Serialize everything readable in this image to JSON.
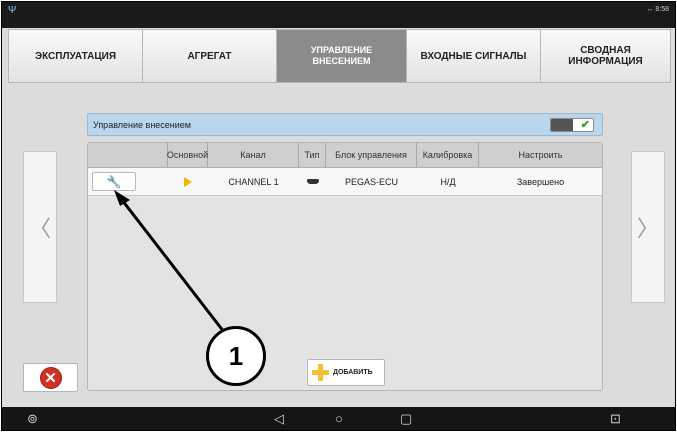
{
  "statusbar": {
    "left_icon": "Ψ",
    "time": "↔ 8:58"
  },
  "tabs": [
    {
      "label": "ЭКСПЛУАТАЦИЯ",
      "active": false
    },
    {
      "label": "АГРЕГАТ",
      "active": false
    },
    {
      "label": "УПРАВЛЕНИЕ ВНЕСЕНИЕМ",
      "active": true
    },
    {
      "label": "ВХОДНЫЕ СИГНАЛЫ",
      "active": false
    },
    {
      "label": "СВОДНАЯ ИНФОРМАЦИЯ",
      "active": false
    }
  ],
  "header": {
    "title": "Управление внесением",
    "toggle_on": true
  },
  "table": {
    "columns": [
      "",
      "Основной",
      "Канал",
      "Тип",
      "Блок управления",
      "Калибровка",
      "Настроить"
    ],
    "rows": [
      {
        "main_icon": "play-icon",
        "channel": "CHANNEL 1",
        "type_icon": "device-icon",
        "control_unit": "PEGAS-ECU",
        "calibration": "Н/Д",
        "setup": "Завершено"
      }
    ]
  },
  "buttons": {
    "add_label": "ДОБАВИТЬ"
  },
  "nav": {
    "left_arrow": "〈",
    "right_arrow": "〉"
  },
  "navbar": {
    "home": "⊚",
    "back": "◁",
    "circle": "○",
    "square": "▢",
    "screenshot": "⊡"
  },
  "callout": {
    "number": "1"
  },
  "colors": {
    "header_bar": "#b9d6ec",
    "accent_yellow": "#f3b400",
    "close_red": "#cf3222"
  }
}
